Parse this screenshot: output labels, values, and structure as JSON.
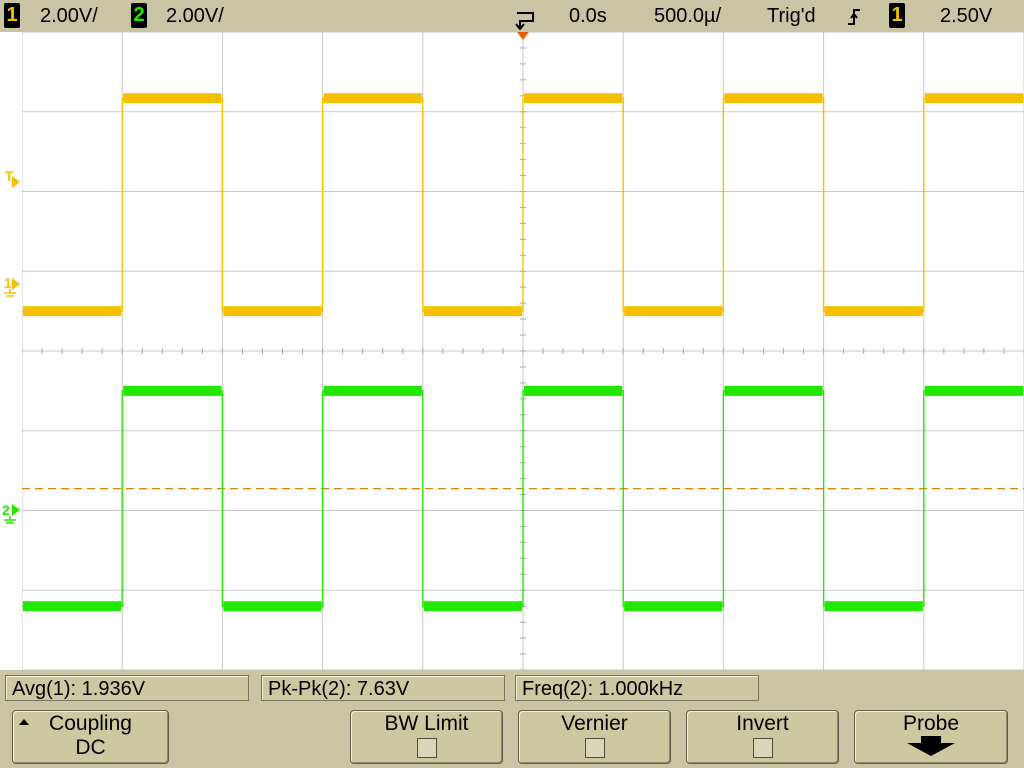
{
  "colors": {
    "ch1": "#f5c000",
    "ch2": "#22e800",
    "grid": "#c8c8c8",
    "trigger_line": "#e08000",
    "background": "#ffffff",
    "panel": "#c8c4a4"
  },
  "topbar": {
    "ch1_num": "1",
    "ch1_scale": "2.00V/",
    "ch2_num": "2",
    "ch2_scale": "2.00V/",
    "time_delay": "0.0s",
    "time_scale": "500.0µ/",
    "trig_status": "Trig'd",
    "trig_slope_icon": "rising-edge-icon",
    "trig_source": "1",
    "trig_level": "2.50V"
  },
  "markers": {
    "trigger_level": "T",
    "ch1_ground": "1",
    "ch2_ground": "2"
  },
  "measurements": {
    "avg": "Avg(1): 1.936V",
    "pkpk": "Pk-Pk(2): 7.63V",
    "freq": "Freq(2): 1.000kHz"
  },
  "softkeys": {
    "coupling_label": "Coupling",
    "coupling_value": "DC",
    "bw_limit_label": "BW Limit",
    "vernier_label": "Vernier",
    "invert_label": "Invert",
    "probe_label": "Probe"
  },
  "chart_data": {
    "type": "line",
    "title": "",
    "grid": true,
    "xlim_divisions": [
      0,
      10
    ],
    "ylim_divisions": [
      0,
      8
    ],
    "series": [
      {
        "name": "",
        "color": "#f5c000",
        "period_div": 2,
        "x_first_rise_div": 1.0,
        "high_div": 0.83,
        "low_div": 3.5,
        "start_level": "low"
      },
      {
        "name": "",
        "color": "#22e800",
        "period_div": 2,
        "x_first_rise_div": 1.0,
        "high_div": 4.5,
        "low_div": 7.2,
        "start_level": "low"
      }
    ]
  }
}
